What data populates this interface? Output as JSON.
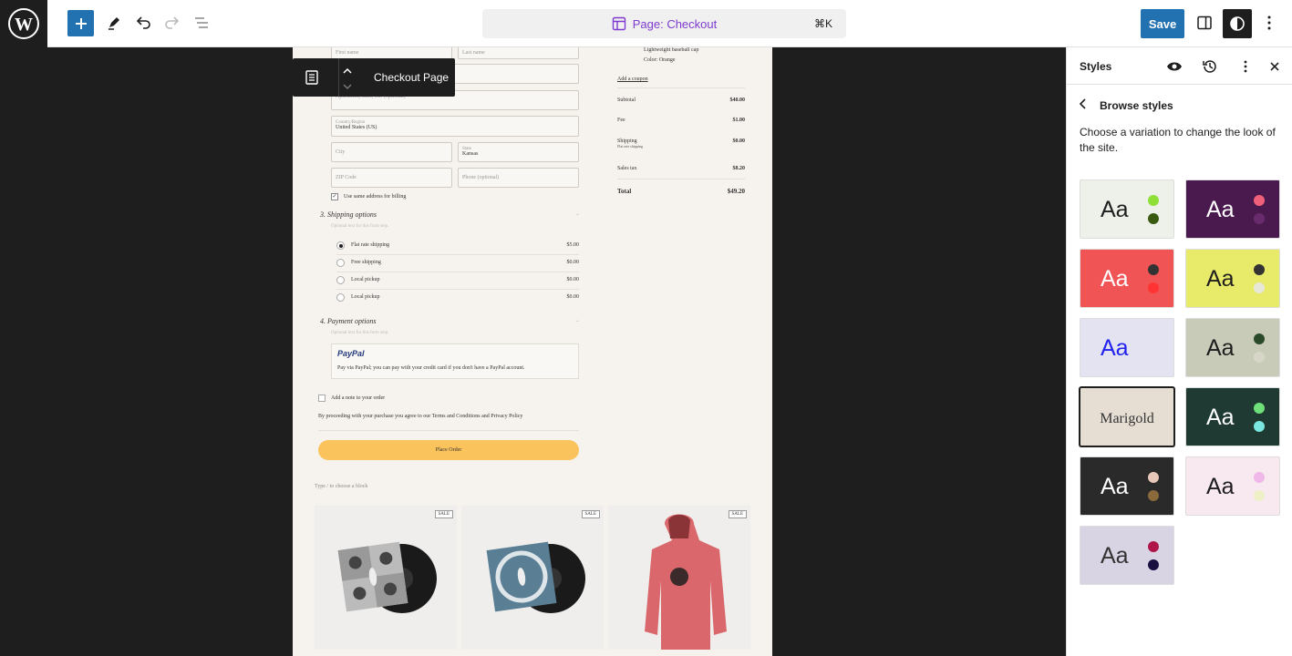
{
  "topbar": {
    "document_title": "Page: Checkout",
    "shortcut": "⌘K",
    "save_label": "Save"
  },
  "block_toolbar": {
    "label": "Checkout Page"
  },
  "checkout": {
    "fields": {
      "first_name": "First name",
      "last_name": "Last name",
      "apartment": "Apartment, suite, etc. (optional)",
      "country_label": "Country/Region",
      "country_value": "United States (US)",
      "city": "City",
      "state_label": "State",
      "state_value": "Kansas",
      "zip": "ZIP Code",
      "phone": "Phone (optional)"
    },
    "same_billing": "Use same address for billing",
    "shipping_title": "3.  Shipping options",
    "shipping_note": "Optional text for this form step.",
    "shipping_options": [
      {
        "label": "Flat rate shipping",
        "price": "$5.00"
      },
      {
        "label": "Free shipping",
        "price": "$0.00"
      },
      {
        "label": "Local pickup",
        "price": "$0.00"
      },
      {
        "label": "Local pickup",
        "price": "$0.00"
      }
    ],
    "payment_title": "4.  Payment options",
    "payment_note": "Optional text for this form step.",
    "paypal_logo": "PayPal",
    "paypal_text": "Pay via PayPal; you can pay with your credit card if you don't have a PayPal account.",
    "add_note": "Add a note to your order",
    "terms": "By proceeding with your purchase you agree to our Terms and Conditions and Privacy Policy",
    "place_order": "Place Order",
    "type_hint": "Type / to choose a block"
  },
  "summary": {
    "item_name": "Lightweight baseball cap",
    "item_color": "Color: Orange",
    "coupon": "Add a coupon",
    "rows": [
      {
        "label": "Subtotal",
        "amount": "$40.00"
      },
      {
        "label": "Fee",
        "amount": "$1.00"
      },
      {
        "label": "Shipping",
        "sub": "Flat rate shipping",
        "amount": "$0.00"
      },
      {
        "label": "Sales tax",
        "amount": "$8.20"
      }
    ],
    "total_label": "Total",
    "total_amount": "$49.20"
  },
  "products": [
    {
      "badge": "SALE",
      "kind": "vinyl-grid"
    },
    {
      "badge": "SALE",
      "kind": "vinyl-blue"
    },
    {
      "badge": "SALE",
      "kind": "hoodie"
    }
  ],
  "sidebar": {
    "title": "Styles",
    "browse_label": "Browse styles",
    "description": "Choose a variation to change the look of the site.",
    "variations": [
      {
        "text": "Aa",
        "bg": "#eef0ea",
        "fg": "#1e1e1e",
        "dot1": "#8fe036",
        "dot2": "#3a5a12"
      },
      {
        "text": "Aa",
        "bg": "#4a1a4e",
        "fg": "#ffffff",
        "dot1": "#f0607a",
        "dot2": "#6a2a6e"
      },
      {
        "text": "Aa",
        "bg": "#f05454",
        "fg": "#ffffff",
        "dot1": "#333333",
        "dot2": "#ff3333"
      },
      {
        "text": "Aa",
        "bg": "#e8ea6a",
        "fg": "#1e1e1e",
        "dot1": "#333333",
        "dot2": "#e8e8d8"
      },
      {
        "text": "Aa",
        "bg": "#e3e3f2",
        "fg": "#2222ee",
        "dot1": "#e3e3f2",
        "dot2": "#e3e3f2"
      },
      {
        "text": "Aa",
        "bg": "#c8cbb8",
        "fg": "#1e1e1e",
        "dot1": "#2a4a2a",
        "dot2": "#d8d6c8"
      },
      {
        "text": "Marigold",
        "bg": "#e6ddd3",
        "fg": "#333333",
        "dot1": "",
        "dot2": ""
      },
      {
        "text": "Aa",
        "bg": "#1e3a33",
        "fg": "#ffffff",
        "dot1": "#6ee07a",
        "dot2": "#7ae8e0"
      },
      {
        "text": "Aa",
        "bg": "#2a2a2a",
        "fg": "#ffffff",
        "dot1": "#e8c8b8",
        "dot2": "#8a6a3a"
      },
      {
        "text": "Aa",
        "bg": "#f8e8f0",
        "fg": "#1e1e1e",
        "dot1": "#f0b8e8",
        "dot2": "#f0f0c8"
      },
      {
        "text": "Aa",
        "bg": "#d8d4e4",
        "fg": "#333333",
        "dot1": "#b0154a",
        "dot2": "#1a1040"
      }
    ]
  }
}
